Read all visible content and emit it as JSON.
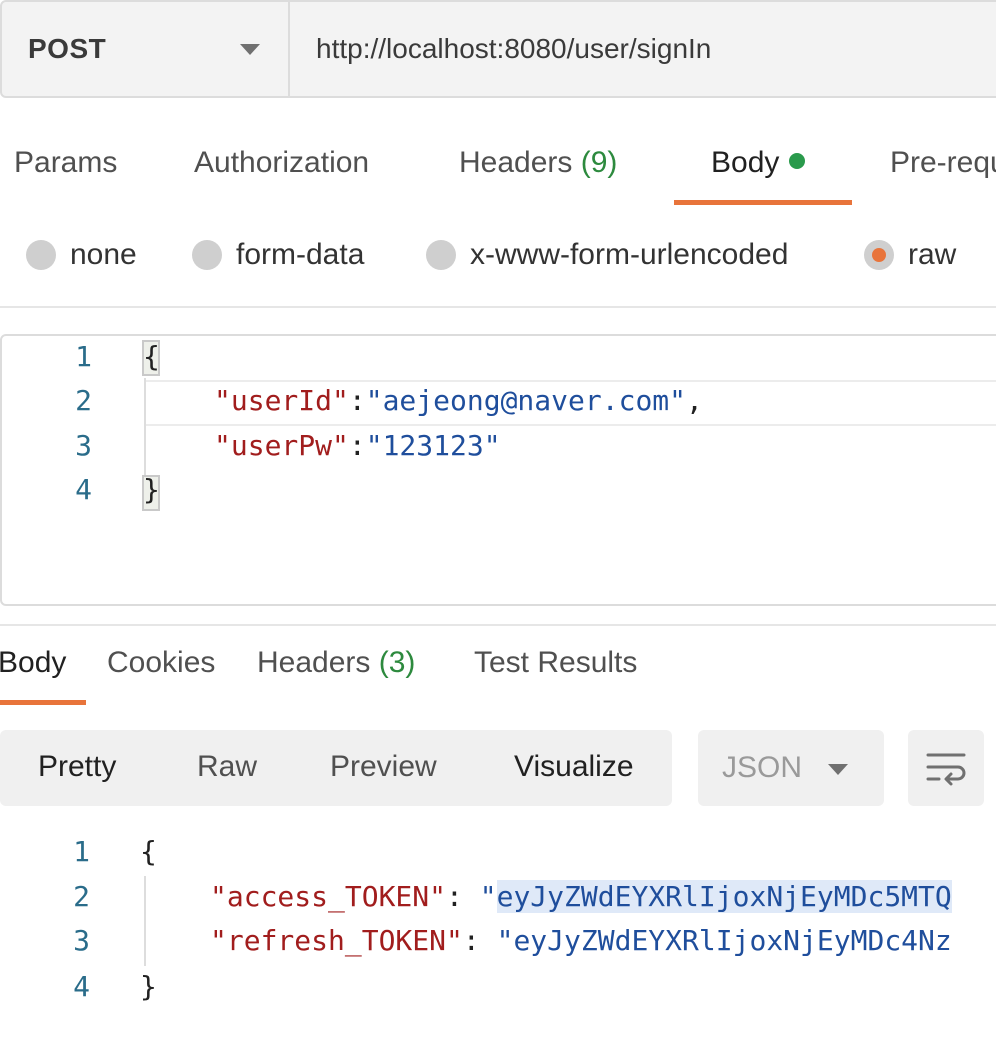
{
  "request": {
    "method": "POST",
    "url": "http://localhost:8080/user/signIn"
  },
  "request_tabs": {
    "params": "Params",
    "authorization": "Authorization",
    "headers_label": "Headers",
    "headers_count": "(9)",
    "body": "Body",
    "pre_request": "Pre-requ"
  },
  "body_types": {
    "none": "none",
    "form_data": "form-data",
    "urlencoded": "x-www-form-urlencoded",
    "raw": "raw",
    "selected": "raw"
  },
  "request_body": {
    "line_numbers": [
      "1",
      "2",
      "3",
      "4"
    ],
    "open_brace": "{",
    "close_brace": "}",
    "key1": "\"userId\"",
    "val1": "\"aejeong@naver.com\"",
    "key2": "\"userPw\"",
    "val2": "\"123123\""
  },
  "response_tabs": {
    "body": "Body",
    "cookies": "Cookies",
    "headers_label": "Headers",
    "headers_count": "(3)",
    "test_results": "Test Results"
  },
  "response_toolbar": {
    "pretty": "Pretty",
    "raw": "Raw",
    "preview": "Preview",
    "visualize": "Visualize",
    "format": "JSON",
    "wrap_icon": "wrap-lines-icon"
  },
  "response_body": {
    "line_numbers": [
      "1",
      "2",
      "3",
      "4"
    ],
    "open_brace": "{",
    "close_brace": "}",
    "key1": "\"access_TOKEN\"",
    "val1_quote": "\"",
    "val1": "eyJyZWdEYXRlIjoxNjEyMDc5MTQ",
    "key2": "\"refresh_TOKEN\"",
    "val2": "\"eyJyZWdEYXRlIjoxNjEyMDc4Nz"
  },
  "colors": {
    "accent": "#e8743b",
    "status_green": "#2a9a4c",
    "json_key": "#a11d1d",
    "json_string": "#1f4e9c"
  }
}
